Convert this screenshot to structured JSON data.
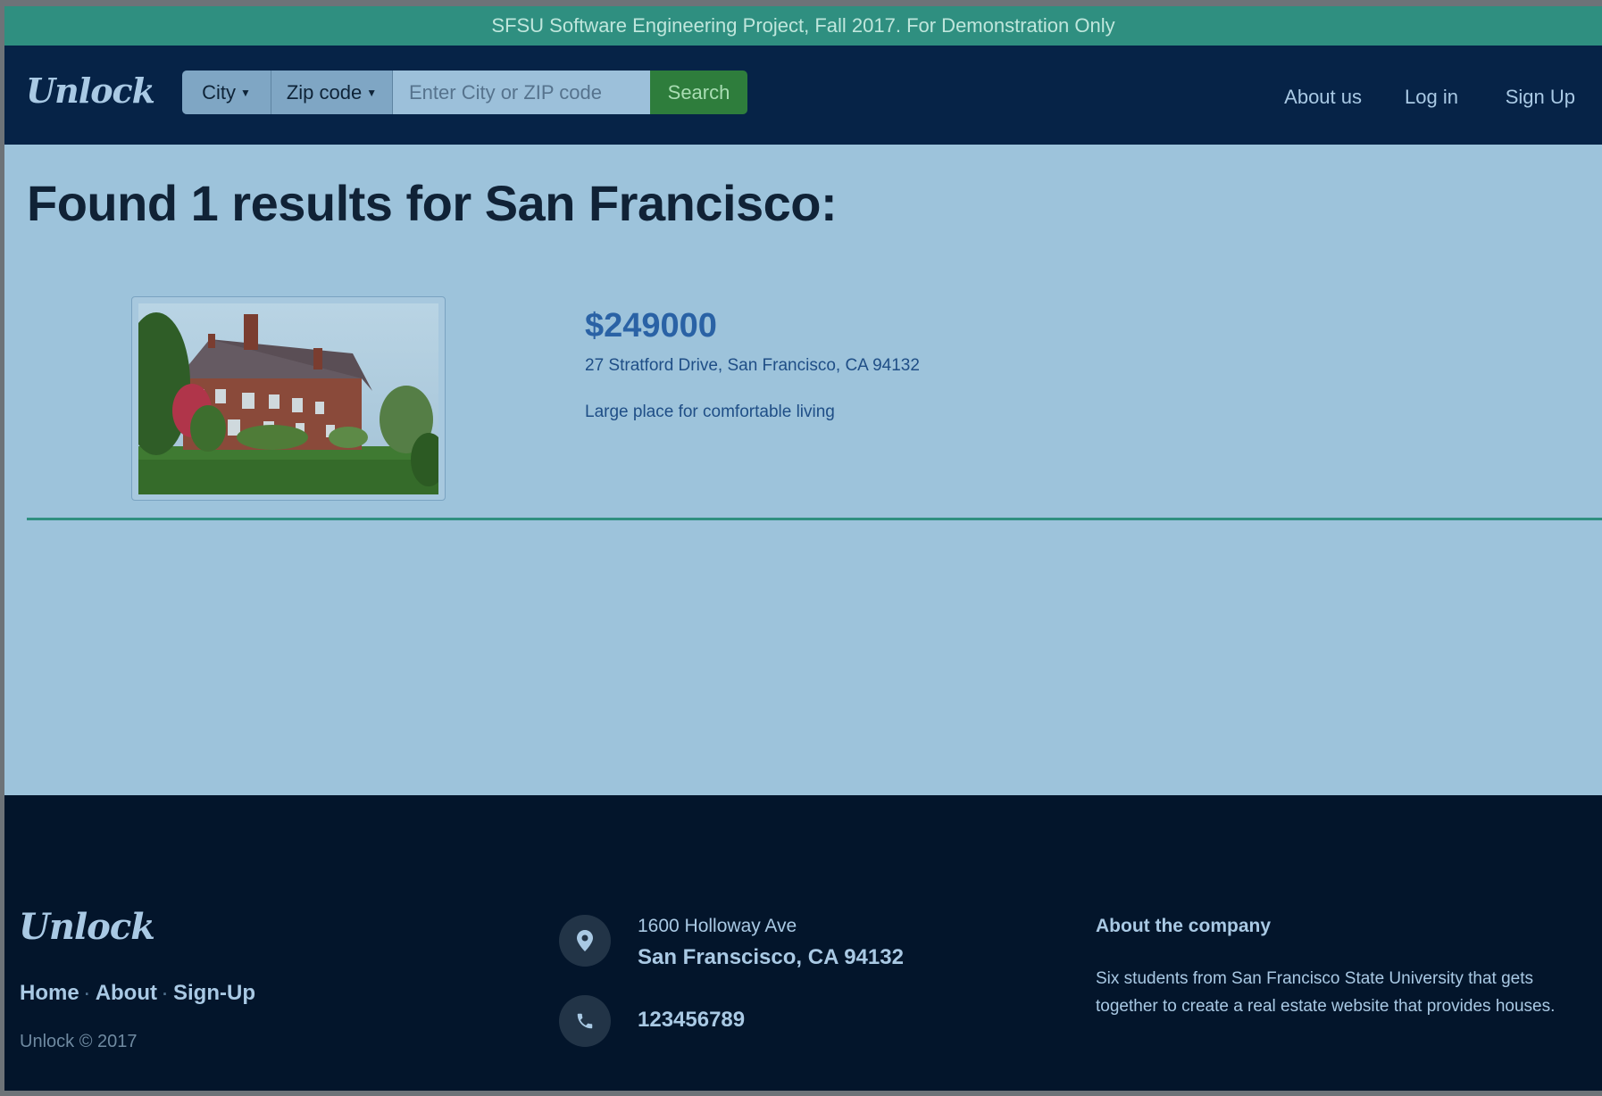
{
  "banner": {
    "text": "SFSU Software Engineering Project, Fall 2017. For Demonstration Only"
  },
  "navbar": {
    "logo": "Unlock",
    "search": {
      "city_dropdown": "City",
      "zip_dropdown": "Zip code",
      "placeholder": "Enter City or ZIP code",
      "value": "",
      "button": "Search"
    },
    "links": [
      "About us",
      "Log in",
      "Sign Up"
    ]
  },
  "main": {
    "title": "Found 1 results for San Francisco:",
    "listings": [
      {
        "price": "$249000",
        "address": "27 Stratford Drive, San Francisco, CA 94132",
        "description": "Large place for comfortable living"
      }
    ]
  },
  "footer": {
    "logo": "Unlock",
    "links": [
      "Home",
      "About",
      "Sign-Up"
    ],
    "copyright": "Unlock © 2017",
    "address_line1": "1600 Holloway Ave",
    "address_line2": "San Franscisco, CA 94132",
    "phone": "123456789",
    "about_title": "About the company",
    "about_text": "Six students from San Francisco State University that gets together to create a real estate website that provides houses."
  },
  "colors": {
    "banner": "#2f8f80",
    "navbar": "#062347",
    "page_background": "#9dc3db",
    "footer": "#03152b",
    "search_button": "#2e7d3c",
    "price": "#2a62a5"
  },
  "icons": [
    "map-marker-icon",
    "phone-icon",
    "caret-down-icon"
  ]
}
